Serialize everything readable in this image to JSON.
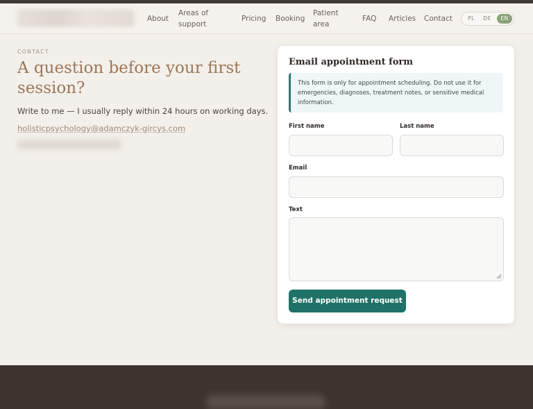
{
  "nav": {
    "links": [
      "About",
      "Areas of support",
      "Pricing",
      "Booking",
      "Patient area",
      "FAQ",
      "Articles",
      "Contact"
    ],
    "languages": [
      "PL",
      "DE",
      "EN"
    ],
    "active_language": "EN"
  },
  "contact": {
    "eyebrow": "CONTACT",
    "headline": "A question before your first session?",
    "lead": "Write to me — I usually reply within 24 hours on working days.",
    "email": "holisticpsychology@adamczyk-gircys.com"
  },
  "form": {
    "title": "Email appointment form",
    "notice": "This form is only for appointment scheduling. Do not use it for emergencies, diagnoses, treatment notes, or sensitive medical information.",
    "first_name_label": "First name",
    "last_name_label": "Last name",
    "email_label": "Email",
    "text_label": "Text",
    "first_name_value": "",
    "last_name_value": "",
    "email_value": "",
    "text_value": "",
    "submit_label": "Send appointment request"
  },
  "colors": {
    "accent": "#1f7268",
    "heading": "#9b7658",
    "active_language": "#8aa27a",
    "footer": "#3d3430"
  }
}
